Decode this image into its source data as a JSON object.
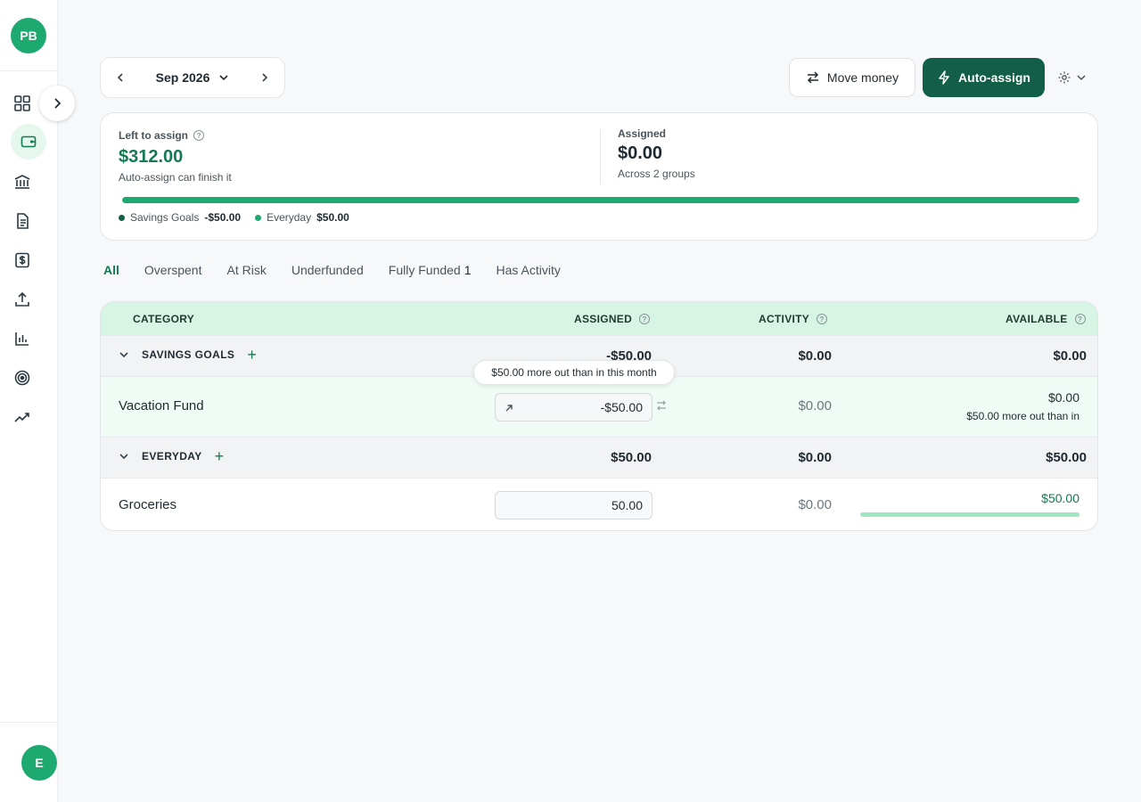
{
  "sidebar": {
    "user_initials": "PB",
    "bottom_initials": "E",
    "items": [
      {
        "name": "dashboard-icon"
      },
      {
        "name": "wallet-icon",
        "active": true
      },
      {
        "name": "bank-icon"
      },
      {
        "name": "document-icon"
      },
      {
        "name": "dollar-icon"
      },
      {
        "name": "upload-icon"
      },
      {
        "name": "bar-chart-icon"
      },
      {
        "name": "target-icon"
      },
      {
        "name": "trend-icon"
      }
    ]
  },
  "header": {
    "month": "Sep 2026",
    "move_money": "Move money",
    "auto_assign": "Auto-assign"
  },
  "summary": {
    "left_label": "Left to assign",
    "left_amount": "$312.00",
    "left_sub": "Auto-assign can finish it",
    "assigned_label": "Assigned",
    "assigned_amount": "$0.00",
    "assigned_sub": "Across 2 groups",
    "progress": 1.0,
    "legend": [
      {
        "label": "Savings Goals",
        "value": "-$50.00",
        "color": "#135e46"
      },
      {
        "label": "Everyday",
        "value": "$50.00",
        "color": "#1ea971"
      }
    ]
  },
  "tabs": [
    {
      "label": "All",
      "active": true
    },
    {
      "label": "Overspent"
    },
    {
      "label": "At Risk"
    },
    {
      "label": "Underfunded"
    },
    {
      "label": "Fully Funded",
      "count": "1"
    },
    {
      "label": "Has Activity"
    }
  ],
  "table": {
    "headers": {
      "category": "CATEGORY",
      "assigned": "ASSIGNED",
      "activity": "ACTIVITY",
      "available": "AVAILABLE"
    },
    "groups": [
      {
        "name": "SAVINGS GOALS",
        "assigned": "-$50.00",
        "activity": "$0.00",
        "available": "$0.00",
        "items": [
          {
            "name": "Vacation Fund",
            "assigned": "-$50.00",
            "activity": "$0.00",
            "available": "$0.00",
            "available_note": "$50.00 more out than in",
            "tooltip": "$50.00 more out than in this month"
          }
        ]
      },
      {
        "name": "EVERYDAY",
        "assigned": "$50.00",
        "activity": "$0.00",
        "available": "$50.00",
        "items": [
          {
            "name": "Groceries",
            "assigned": "50.00",
            "activity": "$0.00",
            "available": "$50.00",
            "funded_fraction": 1.0
          }
        ]
      }
    ]
  },
  "colors": {
    "accent": "#147a52",
    "primary_button": "#135e46",
    "header_bg": "#d6f5e4"
  }
}
